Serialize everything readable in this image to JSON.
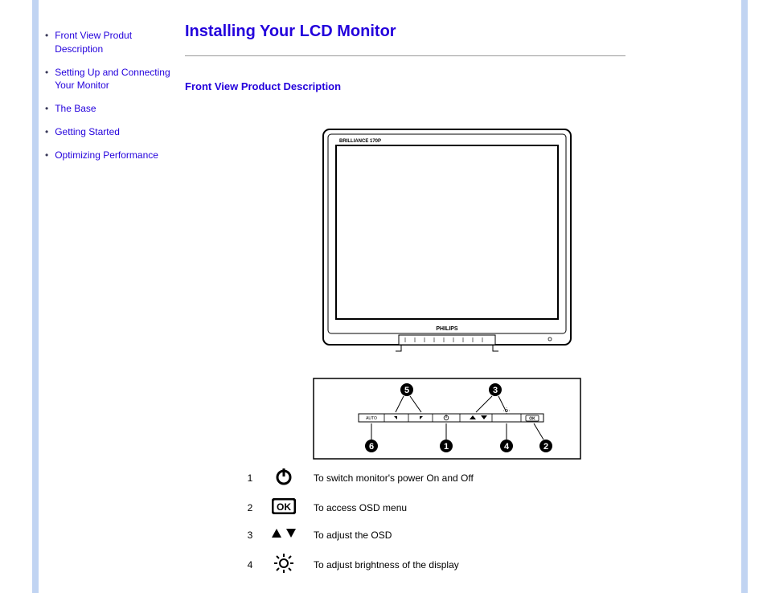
{
  "page_title": "Installing Your LCD Monitor",
  "section_heading": "Front View Product Description",
  "sidebar": {
    "items": [
      {
        "label": "Front View Produt Description"
      },
      {
        "label": "Setting Up and Connecting Your Monitor"
      },
      {
        "label": "The Base"
      },
      {
        "label": "Getting Started"
      },
      {
        "label": "Optimizing Performance"
      }
    ]
  },
  "monitor": {
    "brand_top": "BRILLIANCE 170P",
    "brand_bottom": "PHILIPS"
  },
  "panel": {
    "markers_top": [
      {
        "id": "5",
        "label": "5"
      },
      {
        "id": "3",
        "label": "3"
      }
    ],
    "markers_bottom": [
      {
        "id": "6",
        "label": "6"
      },
      {
        "id": "1",
        "label": "1"
      },
      {
        "id": "4",
        "label": "4"
      },
      {
        "id": "2",
        "label": "2"
      }
    ],
    "bar_labels": {
      "auto": "AUTO",
      "ok": "OK"
    }
  },
  "legend": [
    {
      "num": "1",
      "icon": "power-icon",
      "desc": "To switch monitor's power On and Off"
    },
    {
      "num": "2",
      "icon": "ok-icon",
      "desc": "To access OSD menu"
    },
    {
      "num": "3",
      "icon": "arrows-icon",
      "desc": "To adjust the OSD"
    },
    {
      "num": "4",
      "icon": "brightness-icon",
      "desc": "To adjust brightness of the display"
    }
  ]
}
